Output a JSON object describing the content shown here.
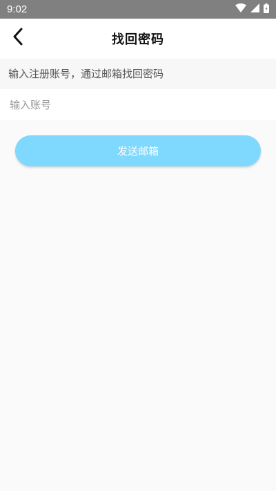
{
  "status_bar": {
    "time": "9:02",
    "icons": [
      "wifi-icon",
      "signal-icon",
      "battery-icon"
    ]
  },
  "app_bar": {
    "title": "找回密码",
    "back_icon": "chevron-left-icon"
  },
  "form": {
    "hint": "输入注册账号，通过邮箱找回密码",
    "account_value": "",
    "account_placeholder": "输入账号",
    "send_label": "发送邮箱"
  },
  "colors": {
    "status_bar": "#808080",
    "button": "#7fd8fd",
    "background": "#fafafa"
  }
}
